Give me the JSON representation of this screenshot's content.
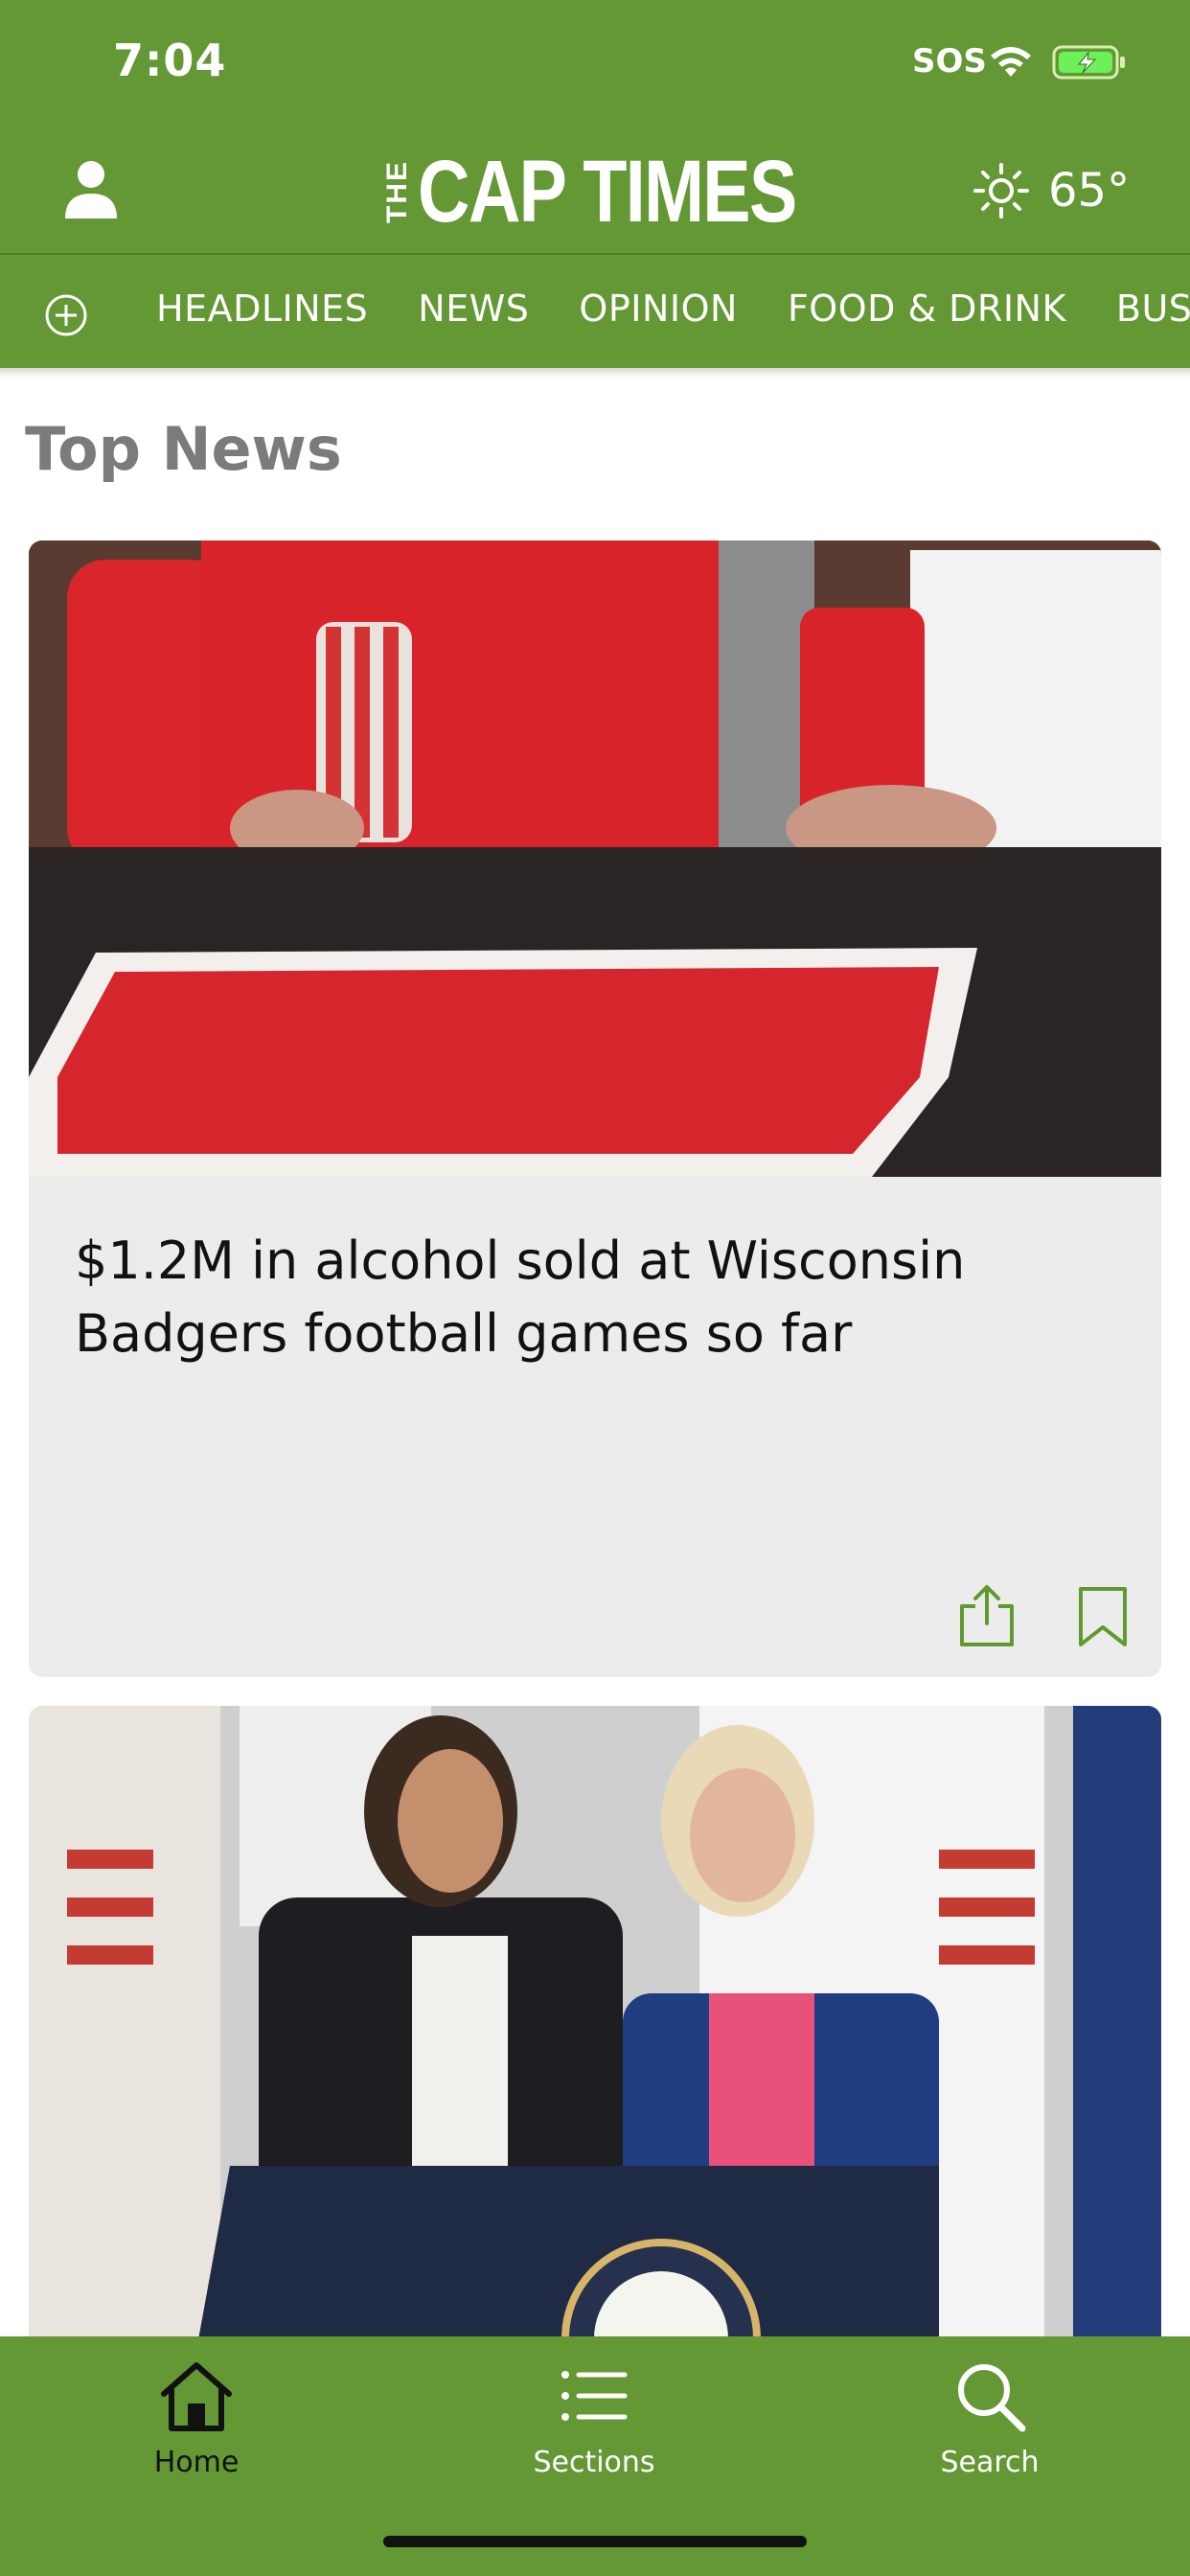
{
  "status_bar": {
    "time": "7:04",
    "sos": "SOS",
    "wifi_icon": "wifi-icon",
    "battery_icon": "battery-charging-icon"
  },
  "header": {
    "profile_icon": "person-icon",
    "logo_prefix": "THE",
    "logo_name": "CAP TIMES",
    "weather_icon": "sun-icon",
    "temperature": "65°"
  },
  "nav": {
    "add_icon": "plus-circle-icon",
    "items": [
      "HEADLINES",
      "NEWS",
      "OPINION",
      "FOOD & DRINK",
      "BUSINESS"
    ]
  },
  "main": {
    "section_title": "Top News",
    "articles": [
      {
        "headline": "$1.2M in alcohol sold at Wisconsin Badgers football games so far",
        "share_icon": "share-icon",
        "bookmark_icon": "bookmark-icon"
      },
      {
        "headline": ""
      }
    ]
  },
  "tabbar": {
    "tabs": [
      {
        "label": "Home",
        "icon": "home-icon",
        "active": true
      },
      {
        "label": "Sections",
        "icon": "list-icon",
        "active": false
      },
      {
        "label": "Search",
        "icon": "search-icon",
        "active": false
      }
    ]
  },
  "colors": {
    "brand_green": "#639834",
    "card_bg": "#ececec",
    "accent_green": "#5f9a2f"
  }
}
